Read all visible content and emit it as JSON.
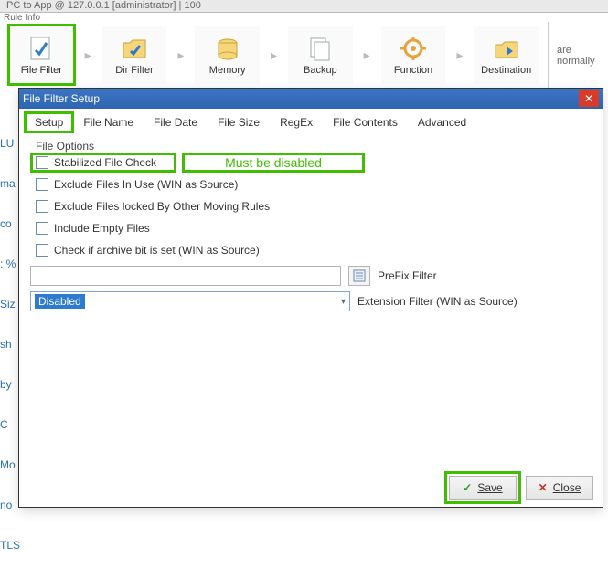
{
  "header": {
    "breadcrumb": "IPC to App @ 127.0.0.1 [administrator]   |   100",
    "subline": "Rule Info"
  },
  "ribbon": {
    "items": [
      {
        "label": "File Filter",
        "icon": "file-filter-icon",
        "highlighted": true
      },
      {
        "label": "Dir Filter",
        "icon": "dir-filter-icon"
      },
      {
        "label": "Memory",
        "icon": "memory-icon"
      },
      {
        "label": "Backup",
        "icon": "backup-icon"
      },
      {
        "label": "Function",
        "icon": "function-icon"
      },
      {
        "label": "Destination",
        "icon": "destination-icon"
      }
    ]
  },
  "bg": {
    "right_text": "are normally",
    "left_fragments": [
      "LU",
      "ma",
      "co",
      ": %",
      "Siz",
      "sh",
      "by",
      "C",
      "Mo",
      "no",
      "TLS"
    ]
  },
  "dialog": {
    "title": "File Filter Setup",
    "tabs": [
      "Setup",
      "File Name",
      "File Date",
      "File Size",
      "RegEx",
      "File Contents",
      "Advanced"
    ],
    "active_tab": 0,
    "fieldset_label": "File Options",
    "checkboxes": [
      "Stabilized File Check",
      "Exclude Files In Use (WIN as Source)",
      "Exclude Files locked By Other Moving Rules",
      "Include Empty Files",
      "Check if archive bit is set (WIN as Source)"
    ],
    "annotation": "Must be disabled",
    "prefix_input_value": "",
    "prefix_label": "PreFix Filter",
    "extension_value": "Disabled",
    "extension_label": "Extension Filter (WIN as Source)",
    "save_label": "Save",
    "close_label": "Close"
  },
  "icons": {
    "check_glyph": "✓",
    "close_glyph": "✕"
  }
}
